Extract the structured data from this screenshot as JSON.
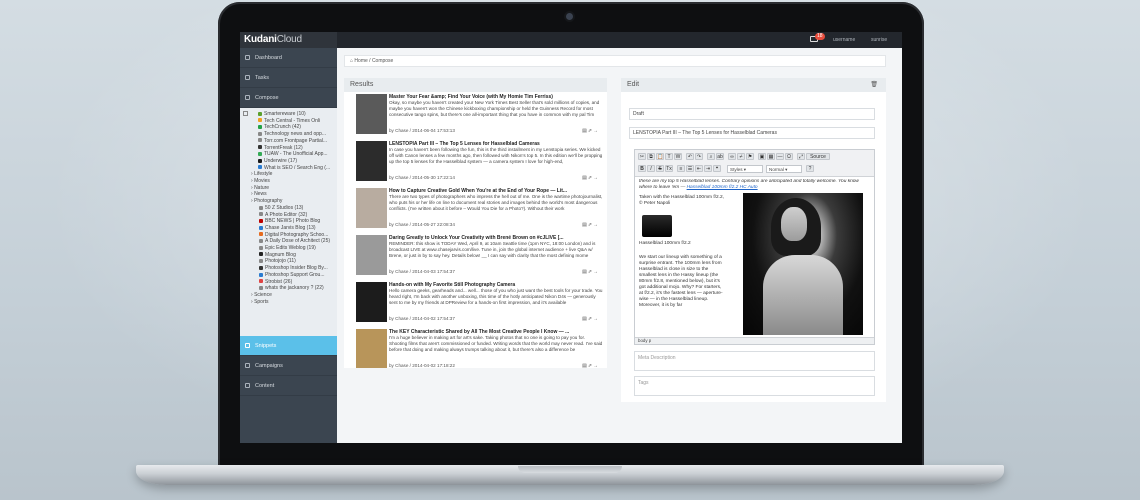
{
  "app": {
    "brand_bold": "Kudani",
    "brand_thin": "Cloud"
  },
  "topbar": {
    "mail_count": "18",
    "user_name": "username",
    "account": "sunrise"
  },
  "sidebar": {
    "nav": [
      {
        "label": "Dashboard"
      },
      {
        "label": "Tasks"
      },
      {
        "label": "Compose"
      }
    ],
    "feeds_top": [
      {
        "label": "Smartereware (10)",
        "color": "#5aa02c"
      },
      {
        "label": "Tech Central - Times Onli",
        "color": "#f0a020"
      },
      {
        "label": "TechCrunch (42)",
        "color": "#22a146"
      },
      {
        "label": "Technology news and opp...",
        "color": "#888"
      },
      {
        "label": "Torr.com Frontpage Partial...",
        "color": "#888"
      },
      {
        "label": "TorrentFreak (12)",
        "color": "#333"
      },
      {
        "label": "TUAW - The Unofficial App...",
        "color": "#3a5"
      },
      {
        "label": "Underwire (17)",
        "color": "#1a1a1a"
      },
      {
        "label": "What is SEO / Search Eng (...",
        "color": "#2a7bd0"
      }
    ],
    "groups": [
      {
        "label": "Lifestyle"
      },
      {
        "label": "Movies"
      },
      {
        "label": "Nature"
      },
      {
        "label": "News"
      },
      {
        "label": "Photography"
      }
    ],
    "photo_feeds": [
      {
        "label": "50 Z Studios (13)",
        "color": "#888"
      },
      {
        "label": "A Photo Editor (32)",
        "color": "#888"
      },
      {
        "label": "BBC NEWS | Photo Blog",
        "color": "#b00"
      },
      {
        "label": "Chase Jarvis Blog (13)",
        "color": "#2a7bd0"
      },
      {
        "label": "Digital Photography Schoo...",
        "color": "#e56b1f"
      },
      {
        "label": "A Daily Dose of Architect (25)",
        "color": "#888"
      },
      {
        "label": "Epic Edits Weblog (19)",
        "color": "#888"
      },
      {
        "label": "Magnum Blog",
        "color": "#222"
      },
      {
        "label": "Photojojo (11)",
        "color": "#888"
      },
      {
        "label": "Photoshop Insider Blog By...",
        "color": "#333"
      },
      {
        "label": "Photoshop Support Grou...",
        "color": "#2a7bd0"
      },
      {
        "label": "Strobist (26)",
        "color": "#e04444"
      },
      {
        "label": "whats the jackanory ? (22)",
        "color": "#888"
      }
    ],
    "groups_bottom": [
      {
        "label": "Science"
      },
      {
        "label": "Sports"
      }
    ],
    "nav_bottom": [
      {
        "label": "Snippets"
      },
      {
        "label": "Campaigns"
      },
      {
        "label": "Content"
      }
    ]
  },
  "breadcrumb": {
    "home": "Home",
    "current": "Compose"
  },
  "results": {
    "title": "Results",
    "items": [
      {
        "title": "Master Your Fear &amp; Find Your Voice (with My Homie Tim Ferriss)",
        "body": "Okay, so maybe you haven't created your New York Times Best Seller that's sold millions of copies, and maybe you haven't won the Chinese kickboxing championship or held the Guinness Record for most consecutive tango spins, but there's one all-important thing that you have in common with my pal Tim",
        "meta": "by Chase / 2014-06-04 17:53:13",
        "thumb": "#5a5a5a"
      },
      {
        "title": "LENSTOPIA Part III – The Top 5 Lenses for Hasselblad Cameras",
        "body": "In case you haven't been following the fun, this is the third installment in my Lenstopia series. We kicked off with Canon lenses a few months ago, then followed with Nikon's top 5. In this edition we'll be propping up the top 5 lenses for the Hasselblad system — a camera system I love for high-end,",
        "meta": "by Chase / 2014-05-30 17:22:14",
        "thumb": "#2c2c2c"
      },
      {
        "title": "How to Capture Creative Gold When You're at the End of Your Rope — Lit...",
        "body": "There are two types of photographers who impress the hell out of me. One is the wartime photojournalist, who puts his or her life on line to document real stories and images behind the world's most dangerous conflicts. (I've written about it before – Would You Die for a Photo?). Without their work",
        "meta": "by Chase / 2014-05-27 22:08:34",
        "thumb": "#b8aca0"
      },
      {
        "title": "Daring Greatly to Unlock Your Creativity with Brené Brown on #cJLIVE [...",
        "body": "REMINDER: this show is TODAY Wed, April 9, at 10am Seattle time (1pm NYC, 18:00 London) and is broadcast LIVE at www.chasejarvis.com/live. Tune in, join the global internet audience + live Q&A w/ Brene, or just in by to say hey. Details below! __ I can say with clarity that the most defining mome",
        "meta": "by Chase / 2014-04-03 17:54:37",
        "thumb": "#9a9a9a"
      },
      {
        "title": "Hands-on with My Favorite Still Photography Camera",
        "body": "Hello camera geeks, gearheads and... well... those of you who just want the best tools for your trade. You heard right, I'm back with another unboxing, this time of the hotly anticipated Nikon D4s — generously sent to me by my friends at DPReview for a hands-on first impression, and it's available",
        "meta": "by Chase / 2014-04-02 17:54:37",
        "thumb": "#1c1c1c"
      },
      {
        "title": "The KEY Characteristic Shared by All The Most Creative People I Know — ...",
        "body": "I'm a huge believer in making art for art's sake. Taking photos that no one is going to pay you for. Shooting films that aren't commissioned or funded. Writing words that the world may never read. I've said before that doing and making always trumps talking about it, but there's also a difference be",
        "meta": "by Chase / 2014-04-02 17:18:22",
        "thumb": "#b8955a"
      }
    ]
  },
  "edit": {
    "title": "Edit",
    "status": "Draft",
    "title_field": "LENSTOPIA Part III – The Top 5 Lenses for Hasselblad Cameras",
    "toolbar": {
      "source": "Source",
      "styles": "Styles",
      "format": "Normal"
    },
    "content": {
      "intro": "these are my top 5 Hasselblad lenses. Contrary opinions are anticipated and totally welcome. You know where to leave 'em —",
      "link": "Hasselblad 100mm f/2.2 HC Auto",
      "caption1": "Taken with the Hasselblad 100mm f/2.2, © Peter Napoli",
      "lens_label": "Hasselblad 100mm f/2.2",
      "para": "We start our lineup with something of a surprise entrant. The 100mm lens from Hasselblad is close in size to the smallest lens in the Hassy lineup (the 80mm f/2.8, mentioned below), but it's got additional mojo. Why? For starters, at f/2.2, it's the fastest lens — aperture-wise — in the Hasselblad lineup. Moreover, it is by far"
    },
    "statusbar": "body  p",
    "meta_placeholder": "Meta Description",
    "tags_placeholder": "Tags"
  }
}
